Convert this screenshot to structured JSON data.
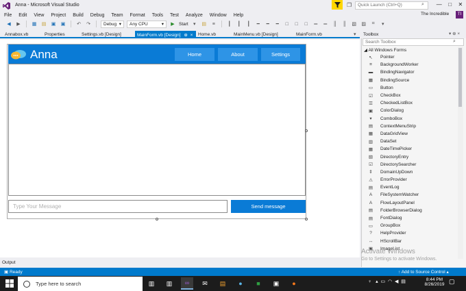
{
  "window": {
    "title": "Anna - Microsoft Visual Studio",
    "quick_launch_placeholder": "Quick Launch (Ctrl+Q)",
    "profile_name": "The Incredible",
    "avatar_initials": "TI"
  },
  "menu": [
    "File",
    "Edit",
    "View",
    "Project",
    "Build",
    "Debug",
    "Team",
    "Format",
    "Tools",
    "Test",
    "Analyze",
    "Window",
    "Help"
  ],
  "toolbar": {
    "config": "Debug",
    "platform": "Any CPU",
    "start_label": "Start"
  },
  "tabs": [
    {
      "label": "Annabox.vb"
    },
    {
      "label": "Properties"
    },
    {
      "label": "Settings.vb [Design]"
    },
    {
      "label": "MainForm.vb [Design]",
      "pin": "⊕",
      "close": "×"
    },
    {
      "label": "Home.vb"
    },
    {
      "label": "MainMenu.vb [Design]"
    },
    {
      "label": "MainForm.vb"
    }
  ],
  "form": {
    "app_title": "Anna",
    "nav": [
      "Home",
      "About",
      "Settings"
    ],
    "message_placeholder": "Type Your Message",
    "send_label": "Send message",
    "accent": "#0a7bd6"
  },
  "output_label": "Output",
  "toolbox": {
    "title": "Toolbox",
    "header_controls": "▾ ⊕ ×",
    "search_placeholder": "Search Toolbox",
    "section": "All Windows Forms",
    "items": [
      {
        "name": "Pointer",
        "icon": "↖"
      },
      {
        "name": "BackgroundWorker",
        "icon": "≡"
      },
      {
        "name": "BindingNavigator",
        "icon": "▬"
      },
      {
        "name": "BindingSource",
        "icon": "▦"
      },
      {
        "name": "Button",
        "icon": "▭"
      },
      {
        "name": "CheckBox",
        "icon": "☑"
      },
      {
        "name": "CheckedListBox",
        "icon": "☰"
      },
      {
        "name": "ColorDialog",
        "icon": "▣"
      },
      {
        "name": "ComboBox",
        "icon": "▾"
      },
      {
        "name": "ContextMenuStrip",
        "icon": "▤"
      },
      {
        "name": "DataGridView",
        "icon": "▦"
      },
      {
        "name": "DataSet",
        "icon": "▥"
      },
      {
        "name": "DateTimePicker",
        "icon": "▦"
      },
      {
        "name": "DirectoryEntry",
        "icon": "▧"
      },
      {
        "name": "DirectorySearcher",
        "icon": "☑"
      },
      {
        "name": "DomainUpDown",
        "icon": "⇕"
      },
      {
        "name": "ErrorProvider",
        "icon": "⚠"
      },
      {
        "name": "EventLog",
        "icon": "▤"
      },
      {
        "name": "FileSystemWatcher",
        "icon": "A"
      },
      {
        "name": "FlowLayoutPanel",
        "icon": "A"
      },
      {
        "name": "FolderBrowserDialog",
        "icon": "▤"
      },
      {
        "name": "FontDialog",
        "icon": "▤"
      },
      {
        "name": "GroupBox",
        "icon": "▭"
      },
      {
        "name": "HelpProvider",
        "icon": "?"
      },
      {
        "name": "HScrollBar",
        "icon": "↔"
      },
      {
        "name": "ImageList",
        "icon": "▣"
      }
    ]
  },
  "watermark": {
    "line1": "Activate Windows",
    "line2": "Go to Settings to activate Windows."
  },
  "statusbar": {
    "left": "Ready",
    "right": "Add to Source Control"
  },
  "taskbar": {
    "search_placeholder": "Type here to search",
    "time": "8:44 PM",
    "date": "8/26/2019"
  }
}
